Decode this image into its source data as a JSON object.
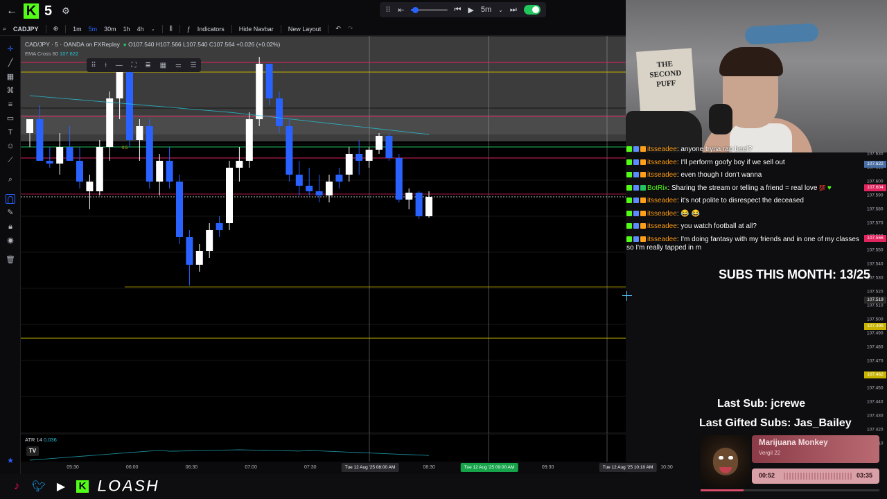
{
  "app": {
    "kick_number": "5"
  },
  "toolbar": {
    "symbol": "CADJPY",
    "intervals": [
      "1m",
      "5m",
      "30m",
      "1h",
      "4h"
    ],
    "active_interval": "5m",
    "indicators_label": "Indicators",
    "hide_navbar_label": "Hide Navbar",
    "new_layout_label": "New Layout"
  },
  "replay": {
    "interval": "5m",
    "speed_fraction": 0.1,
    "enabled": true
  },
  "chart": {
    "legend_title": "CAD/JPY · 5 · OANDA on FXReplay",
    "legend_ohlc": "O107.540 H107.566 L107.540 C107.564 +0.026 (+0.02%)",
    "ema_label": "EMA Cross",
    "ema_length": "60",
    "ema_value": "107.622",
    "atr_label": "ATR",
    "atr_length": "14",
    "atr_value": "0.036",
    "fib_label": "0.5"
  },
  "chart_data": {
    "type": "candlestick",
    "x_axis_ticks": [
      "05:30",
      "06:00",
      "06:30",
      "07:00",
      "07:30",
      "08:00",
      "08:30",
      "09:00",
      "09:30",
      "10:00",
      "10:30"
    ],
    "time_badges": [
      {
        "text": "Tue 12 Aug '25  08:00 AM",
        "color": "#e0e0e0"
      },
      {
        "text": "Tue 12 Aug '25  09:00 AM",
        "color": "#22c55e"
      },
      {
        "text": "Tue 12 Aug '25  10:10 AM",
        "color": "#e0e0e0"
      }
    ],
    "price_ticks": [
      "107.630",
      "107.610",
      "107.600",
      "107.590",
      "107.580",
      "107.570",
      "107.560",
      "107.550",
      "107.540",
      "107.530",
      "107.520",
      "107.510",
      "107.500",
      "107.490",
      "107.480",
      "107.470",
      "107.460",
      "107.450",
      "107.440",
      "107.430",
      "107.420",
      "107.410"
    ],
    "price_badges": [
      {
        "text": "107.622",
        "color": "#4a6fa5"
      },
      {
        "text": "107.604",
        "color": "#e0245e"
      },
      {
        "text": "107.566",
        "color": "#e0245e"
      },
      {
        "text": "107.519",
        "color": "#2a2a2a"
      },
      {
        "text": "107.499",
        "color": "#c8b400"
      },
      {
        "text": "107.462",
        "color": "#c8b400"
      }
    ],
    "ylim": [
      107.4,
      107.68
    ],
    "candles": [
      {
        "o": 107.61,
        "h": 107.62,
        "l": 107.6,
        "c": 107.62,
        "bull": true
      },
      {
        "o": 107.62,
        "h": 107.63,
        "l": 107.59,
        "c": 107.59,
        "bull": false
      },
      {
        "o": 107.59,
        "h": 107.6,
        "l": 107.585,
        "c": 107.588,
        "bull": false
      },
      {
        "o": 107.588,
        "h": 107.61,
        "l": 107.58,
        "c": 107.6,
        "bull": true
      },
      {
        "o": 107.6,
        "h": 107.615,
        "l": 107.59,
        "c": 107.59,
        "bull": false
      },
      {
        "o": 107.59,
        "h": 107.6,
        "l": 107.57,
        "c": 107.575,
        "bull": false
      },
      {
        "o": 107.575,
        "h": 107.58,
        "l": 107.555,
        "c": 107.568,
        "bull": true
      },
      {
        "o": 107.568,
        "h": 107.605,
        "l": 107.565,
        "c": 107.6,
        "bull": true
      },
      {
        "o": 107.6,
        "h": 107.64,
        "l": 107.59,
        "c": 107.635,
        "bull": true
      },
      {
        "o": 107.635,
        "h": 107.66,
        "l": 107.62,
        "c": 107.655,
        "bull": true
      },
      {
        "o": 107.655,
        "h": 107.66,
        "l": 107.6,
        "c": 107.605,
        "bull": false
      },
      {
        "o": 107.605,
        "h": 107.62,
        "l": 107.59,
        "c": 107.615,
        "bull": true
      },
      {
        "o": 107.615,
        "h": 107.62,
        "l": 107.57,
        "c": 107.575,
        "bull": false
      },
      {
        "o": 107.575,
        "h": 107.595,
        "l": 107.565,
        "c": 107.59,
        "bull": true
      },
      {
        "o": 107.59,
        "h": 107.6,
        "l": 107.57,
        "c": 107.575,
        "bull": false
      },
      {
        "o": 107.575,
        "h": 107.58,
        "l": 107.53,
        "c": 107.535,
        "bull": false
      },
      {
        "o": 107.535,
        "h": 107.54,
        "l": 107.5,
        "c": 107.515,
        "bull": false
      },
      {
        "o": 107.515,
        "h": 107.53,
        "l": 107.51,
        "c": 107.525,
        "bull": true
      },
      {
        "o": 107.525,
        "h": 107.545,
        "l": 107.52,
        "c": 107.54,
        "bull": true
      },
      {
        "o": 107.54,
        "h": 107.55,
        "l": 107.535,
        "c": 107.545,
        "bull": false
      },
      {
        "o": 107.545,
        "h": 107.59,
        "l": 107.54,
        "c": 107.585,
        "bull": true
      },
      {
        "o": 107.585,
        "h": 107.6,
        "l": 107.575,
        "c": 107.59,
        "bull": true
      },
      {
        "o": 107.59,
        "h": 107.625,
        "l": 107.585,
        "c": 107.62,
        "bull": true
      },
      {
        "o": 107.62,
        "h": 107.665,
        "l": 107.615,
        "c": 107.66,
        "bull": true
      },
      {
        "o": 107.66,
        "h": 107.66,
        "l": 107.63,
        "c": 107.635,
        "bull": false
      },
      {
        "o": 107.635,
        "h": 107.64,
        "l": 107.61,
        "c": 107.615,
        "bull": false
      },
      {
        "o": 107.615,
        "h": 107.62,
        "l": 107.575,
        "c": 107.58,
        "bull": false
      },
      {
        "o": 107.58,
        "h": 107.59,
        "l": 107.565,
        "c": 107.572,
        "bull": false
      },
      {
        "o": 107.572,
        "h": 107.585,
        "l": 107.565,
        "c": 107.568,
        "bull": false
      },
      {
        "o": 107.568,
        "h": 107.58,
        "l": 107.56,
        "c": 107.565,
        "bull": false
      },
      {
        "o": 107.565,
        "h": 107.58,
        "l": 107.56,
        "c": 107.575,
        "bull": true
      },
      {
        "o": 107.575,
        "h": 107.585,
        "l": 107.57,
        "c": 107.58,
        "bull": false
      },
      {
        "o": 107.58,
        "h": 107.6,
        "l": 107.575,
        "c": 107.595,
        "bull": true
      },
      {
        "o": 107.595,
        "h": 107.605,
        "l": 107.58,
        "c": 107.59,
        "bull": false
      },
      {
        "o": 107.59,
        "h": 107.6,
        "l": 107.585,
        "c": 107.598,
        "bull": true
      },
      {
        "o": 107.598,
        "h": 107.61,
        "l": 107.595,
        "c": 107.608,
        "bull": true
      },
      {
        "o": 107.608,
        "h": 107.61,
        "l": 107.59,
        "c": 107.592,
        "bull": false
      },
      {
        "o": 107.592,
        "h": 107.595,
        "l": 107.56,
        "c": 107.562,
        "bull": false
      },
      {
        "o": 107.562,
        "h": 107.57,
        "l": 107.555,
        "c": 107.567,
        "bull": true
      },
      {
        "o": 107.567,
        "h": 107.568,
        "l": 107.548,
        "c": 107.55,
        "bull": false
      },
      {
        "o": 107.55,
        "h": 107.568,
        "l": 107.549,
        "c": 107.564,
        "bull": true
      }
    ]
  },
  "chat": {
    "messages": [
      {
        "user": "itsseadee",
        "text": ": anyone tryna rap beef?",
        "bot": false
      },
      {
        "user": "itsseadee",
        "text": ": I'll perform goofy boy if we sell out",
        "bot": false
      },
      {
        "user": "itsseadee",
        "text": ": even though I don't wanna",
        "bot": false
      },
      {
        "user": "BotRix",
        "text": ": Sharing the stream or telling a friend = real love",
        "bot": true
      },
      {
        "user": "itsseadee",
        "text": ": it's not polite to disrespect the deceased",
        "bot": false
      },
      {
        "user": "itsseadee",
        "text": ": 😂 😂",
        "bot": false
      },
      {
        "user": "itsseadee",
        "text": ": you watch football at all?",
        "bot": false
      },
      {
        "user": "itsseadee",
        "text": ": I'm doing fantasy with my friends and in one of my classes",
        "bot": false
      }
    ],
    "wrap_line": "so I'm really tapped in m"
  },
  "overlay": {
    "subs_month": "SUBS THIS MONTH: 13/25",
    "last_sub": "Last Sub: jcrewe",
    "last_gifted": "Last Gifted Subs: Jas_Bailey"
  },
  "music": {
    "title": "Marijuana Monkey",
    "artist": "Vergil 22",
    "current": "00:52",
    "total": "03:35",
    "progress": 0.24
  },
  "footer": {
    "brand": "LOASH"
  },
  "colors": {
    "bull": "#ffffff",
    "bear": "#2962ff",
    "kick": "#53fc18",
    "ema": "#26c6da"
  }
}
